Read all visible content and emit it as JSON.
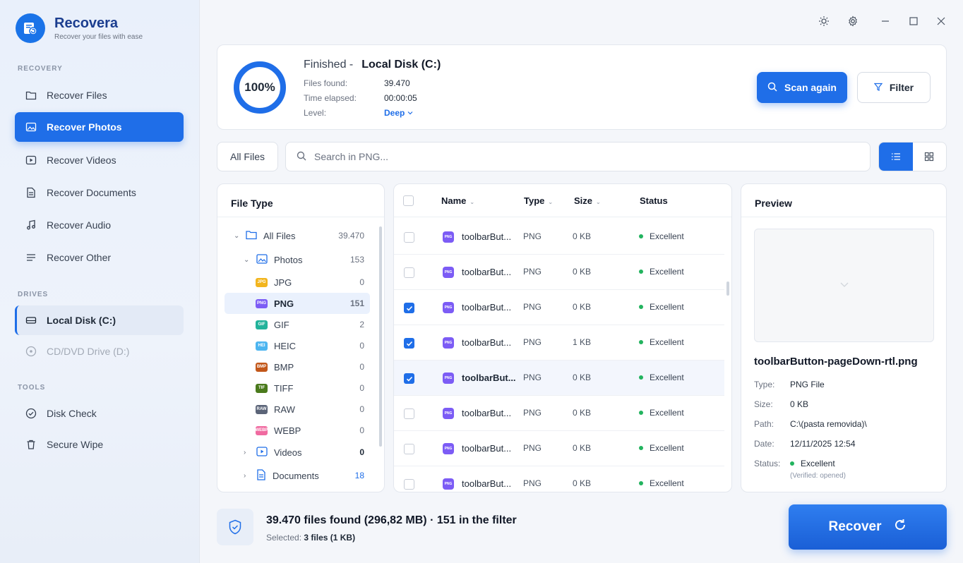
{
  "app": {
    "title": "Recovera",
    "subtitle": "Recover your files with ease"
  },
  "sidebar": {
    "recovery_label": "RECOVERY",
    "recovery_items": [
      {
        "label": "Recover Files",
        "icon": "folder-icon"
      },
      {
        "label": "Recover Photos",
        "icon": "image-icon",
        "active": true
      },
      {
        "label": "Recover Videos",
        "icon": "video-icon"
      },
      {
        "label": "Recover Documents",
        "icon": "document-icon"
      },
      {
        "label": "Recover Audio",
        "icon": "music-icon"
      },
      {
        "label": "Recover Other",
        "icon": "menu-icon"
      }
    ],
    "drives_label": "DRIVES",
    "drives": [
      {
        "label": "Local Disk (C:)",
        "icon": "hard-drive-icon",
        "active": true
      },
      {
        "label": "CD/DVD Drive (D:)",
        "icon": "disc-icon",
        "disabled": true
      }
    ],
    "tools_label": "TOOLS",
    "tools": [
      {
        "label": "Disk Check",
        "icon": "check-circle-icon"
      },
      {
        "label": "Secure Wipe",
        "icon": "trash-icon"
      }
    ]
  },
  "scan": {
    "progress": 100,
    "progress_label": "100%",
    "status": "Finished -",
    "disk": "Local Disk (C:)",
    "files_found_label": "Files found:",
    "files_found": "39.470",
    "time_label": "Time elapsed:",
    "time": "00:00:05",
    "level_label": "Level:",
    "level": "Deep",
    "scan_again": "Scan again",
    "filter": "Filter"
  },
  "search": {
    "all_files": "All Files",
    "placeholder": "Search in PNG..."
  },
  "file_type": {
    "title": "File Type",
    "tree": [
      {
        "label": "All Files",
        "count": "39.470"
      },
      {
        "label": "Photos",
        "count": "153"
      },
      {
        "label": "JPG",
        "count": "0",
        "badge": "JPG",
        "color": "#f2b51e"
      },
      {
        "label": "PNG",
        "count": "151",
        "badge": "PNG",
        "color": "#7c5cf5"
      },
      {
        "label": "GIF",
        "count": "2",
        "badge": "GIF",
        "color": "#22b39b"
      },
      {
        "label": "HEIC",
        "count": "0",
        "badge": "HEI",
        "color": "#4db5f0"
      },
      {
        "label": "BMP",
        "count": "0",
        "badge": "BMP",
        "color": "#c2571a"
      },
      {
        "label": "TIFF",
        "count": "0",
        "badge": "TIF",
        "color": "#4a7a1c"
      },
      {
        "label": "RAW",
        "count": "0",
        "badge": "RAW",
        "color": "#5b6478"
      },
      {
        "label": "WEBP",
        "count": "0",
        "badge": "WEBP",
        "color": "#f06aa0"
      },
      {
        "label": "Videos",
        "count": "0"
      },
      {
        "label": "Documents",
        "count": "18"
      }
    ]
  },
  "file_list": {
    "columns": {
      "name": "Name",
      "type": "Type",
      "size": "Size",
      "status": "Status"
    },
    "rows": [
      {
        "name": "toolbarBut...",
        "type": "PNG",
        "size": "0 KB",
        "status": "Excellent",
        "checked": false
      },
      {
        "name": "toolbarBut...",
        "type": "PNG",
        "size": "0 KB",
        "status": "Excellent",
        "checked": false
      },
      {
        "name": "toolbarBut...",
        "type": "PNG",
        "size": "0 KB",
        "status": "Excellent",
        "checked": true
      },
      {
        "name": "toolbarBut...",
        "type": "PNG",
        "size": "1 KB",
        "status": "Excellent",
        "checked": true
      },
      {
        "name": "toolbarBut...",
        "type": "PNG",
        "size": "0 KB",
        "status": "Excellent",
        "checked": true
      },
      {
        "name": "toolbarBut...",
        "type": "PNG",
        "size": "0 KB",
        "status": "Excellent",
        "checked": false
      },
      {
        "name": "toolbarBut...",
        "type": "PNG",
        "size": "0 KB",
        "status": "Excellent",
        "checked": false
      },
      {
        "name": "toolbarBut...",
        "type": "PNG",
        "size": "0 KB",
        "status": "Excellent",
        "checked": false
      }
    ]
  },
  "preview": {
    "title": "Preview",
    "filename": "toolbarButton-pageDown-rtl.png",
    "type_label": "Type:",
    "type": "PNG File",
    "size_label": "Size:",
    "size": "0 KB",
    "path_label": "Path:",
    "path": "C:\\(pasta removida)\\",
    "date_label": "Date:",
    "date": "12/11/2025 12:54",
    "status_label": "Status:",
    "status": "Excellent",
    "status_note": "(Verified: opened)"
  },
  "footer": {
    "summary": "39.470 files found (296,82 MB) · 151 in the filter",
    "selected_label": "Selected:",
    "selected": "3 files (1 KB)",
    "recover": "Recover"
  },
  "colors": {
    "accent": "#1f6ee8",
    "success": "#22b35e"
  }
}
